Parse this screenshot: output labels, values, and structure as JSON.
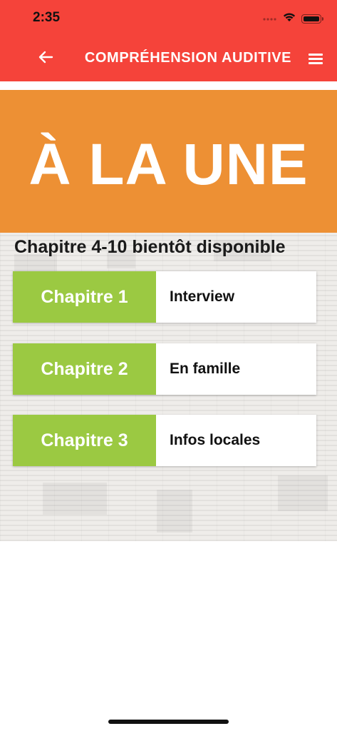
{
  "status_bar": {
    "time": "2:35",
    "icons": [
      "signal-icon",
      "wifi-icon",
      "battery-icon"
    ]
  },
  "header": {
    "title": "COMPRÉHENSION AUDITIVE",
    "back_icon": "arrow-left-icon",
    "menu_icon": "hamburger-menu-icon"
  },
  "hero": {
    "title": "À LA UNE"
  },
  "subtitle": "Chapitre 4-10 bientôt disponible",
  "chapters": [
    {
      "tag": "Chapitre 1",
      "name": "Interview"
    },
    {
      "tag": "Chapitre 2",
      "name": "En famille"
    },
    {
      "tag": "Chapitre 3",
      "name": "Infos locales"
    }
  ],
  "colors": {
    "header": "#f5433a",
    "hero": "#ed9034",
    "chapter_tag": "#9bc942",
    "paper": "#efedea"
  }
}
